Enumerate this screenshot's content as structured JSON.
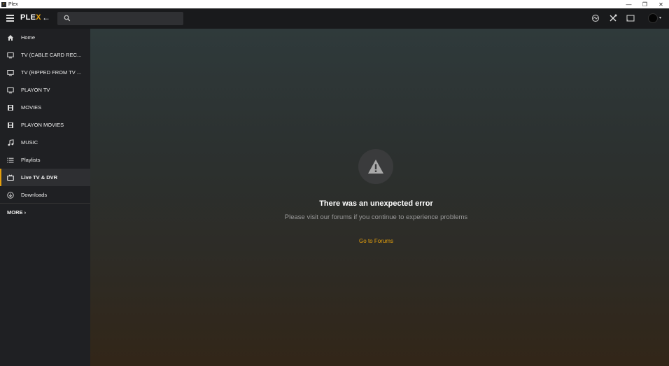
{
  "window": {
    "title": "Plex",
    "app_icon_glyph": "›",
    "minimize": "—",
    "restore": "❐",
    "close": "✕"
  },
  "topbar": {
    "logo_main": "PLE",
    "logo_x": "X",
    "back": "←",
    "search": {
      "placeholder": "",
      "value": ""
    },
    "avatar_caret": "▾"
  },
  "sidebar": {
    "items": [
      {
        "label": "Home",
        "icon": "home-icon"
      },
      {
        "label": "TV (CABLE CARD REC...",
        "icon": "monitor-icon"
      },
      {
        "label": "TV (RIPPED FROM TV ...",
        "icon": "monitor-icon"
      },
      {
        "label": "PLAYON TV",
        "icon": "monitor-icon"
      },
      {
        "label": "MOVIES",
        "icon": "film-icon"
      },
      {
        "label": "PLAYON MOVIES",
        "icon": "film-icon"
      },
      {
        "label": "MUSIC",
        "icon": "music-note-icon"
      },
      {
        "label": "Playlists",
        "icon": "list-icon"
      },
      {
        "label": "Live TV & DVR",
        "icon": "tv-icon",
        "active": true
      },
      {
        "label": "Downloads",
        "icon": "download-icon"
      }
    ],
    "more": "MORE ›"
  },
  "main": {
    "error_title": "There was an unexpected error",
    "error_subtitle": "Please visit our forums if you continue to experience problems",
    "forums_link": "Go to Forums"
  },
  "colors": {
    "accent": "#e5a00d",
    "sidebar_bg": "#1f2023",
    "topbar_bg": "#191a1c"
  }
}
